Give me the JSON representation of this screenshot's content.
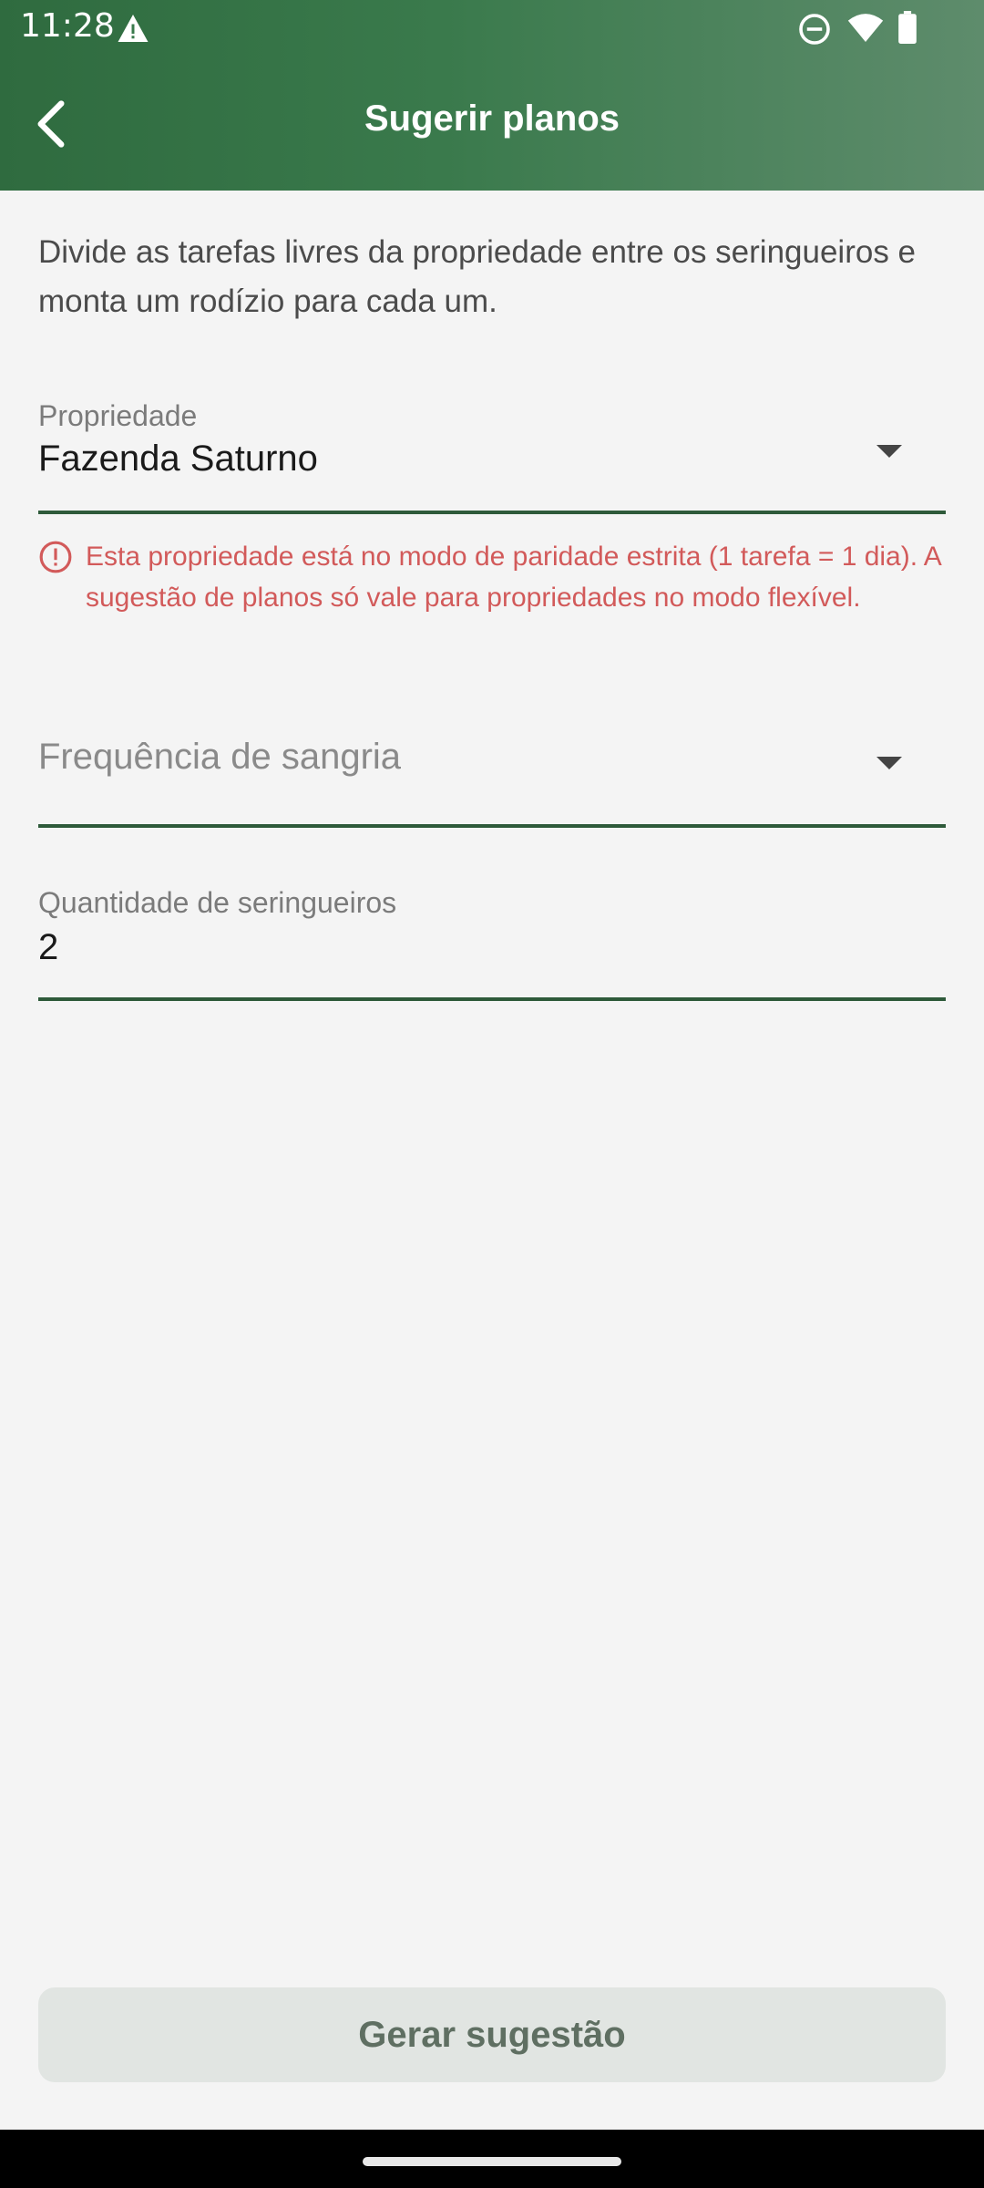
{
  "status_bar": {
    "time": "11:28",
    "icons": [
      "warning-icon",
      "do-not-disturb-icon",
      "wifi-icon",
      "battery-icon"
    ]
  },
  "app_bar": {
    "title": "Sugerir planos",
    "back_icon": "chevron-left-icon"
  },
  "description": "Divide as tarefas livres da propriedade entre os seringueiros e monta um rodízio para cada um.",
  "form": {
    "property": {
      "label": "Propriedade",
      "value": "Fazenda Saturno"
    },
    "property_error": "Esta propriedade está no modo de paridade estrita (1 tarefa = 1 dia). A sugestão de planos só vale para propriedades no modo flexível.",
    "frequency": {
      "placeholder": "Frequência de sangria"
    },
    "tappers": {
      "label": "Quantidade de seringueiros",
      "value": "2"
    }
  },
  "submit_label": "Gerar sugestão",
  "colors": {
    "primary": "#2f6b3f",
    "error": "#d25a5a",
    "background": "#f4f4f4"
  }
}
